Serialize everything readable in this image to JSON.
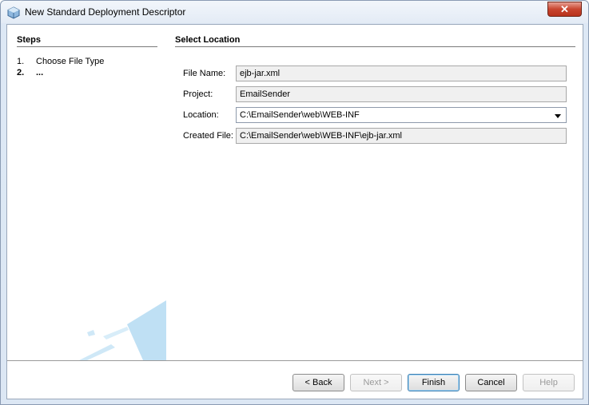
{
  "window": {
    "title": "New Standard Deployment Descriptor",
    "close_glyph": "✕"
  },
  "steps": {
    "heading": "Steps",
    "items": [
      {
        "number": "1.",
        "label": "Choose File Type"
      },
      {
        "number": "2.",
        "label": "..."
      }
    ]
  },
  "content": {
    "heading": "Select Location",
    "file_name": {
      "label": "File Name:",
      "value": "ejb-jar.xml"
    },
    "project": {
      "label": "Project:",
      "value": "EmailSender"
    },
    "location": {
      "label": "Location:",
      "value": "C:\\EmailSender\\web\\WEB-INF"
    },
    "created_file": {
      "label": "Created File:",
      "value": "C:\\EmailSender\\web\\WEB-INF\\ejb-jar.xml"
    }
  },
  "buttons": {
    "back": "< Back",
    "next": "Next >",
    "finish": "Finish",
    "cancel": "Cancel",
    "help": "Help"
  }
}
